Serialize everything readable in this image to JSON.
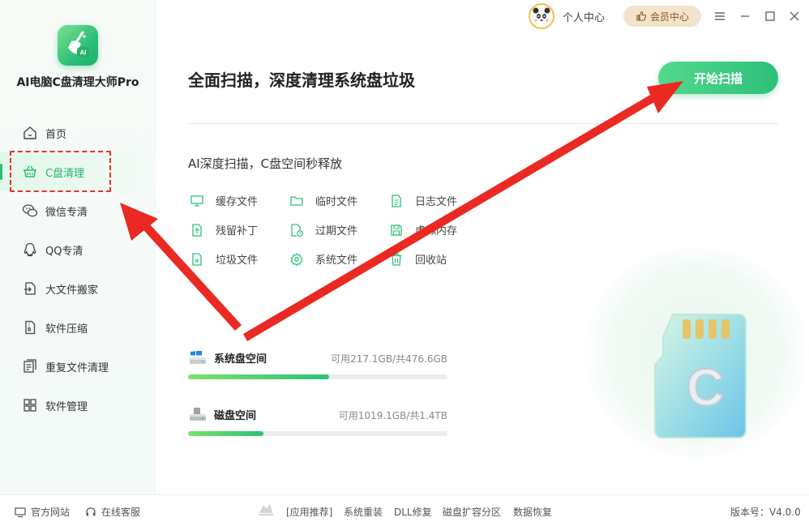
{
  "app": {
    "name": "AI电脑C盘清理大师Pro"
  },
  "topbar": {
    "user_center": "个人中心",
    "vip": "会员中心"
  },
  "sidebar": {
    "items": [
      {
        "label": "首页",
        "icon": "home-icon"
      },
      {
        "label": "C盘清理",
        "icon": "basket-icon",
        "active": true
      },
      {
        "label": "微信专清",
        "icon": "wechat-icon"
      },
      {
        "label": "QQ专清",
        "icon": "qq-icon"
      },
      {
        "label": "大文件搬家",
        "icon": "move-file-icon"
      },
      {
        "label": "软件压缩",
        "icon": "zip-icon"
      },
      {
        "label": "重复文件清理",
        "icon": "duplicate-file-icon"
      },
      {
        "label": "软件管理",
        "icon": "apps-grid-icon"
      }
    ]
  },
  "main": {
    "headline": "全面扫描，深度清理系统盘垃圾",
    "scan_button": "开始扫描",
    "subhead": "AI深度扫描，C盘空间秒释放",
    "features": [
      {
        "label": "缓存文件",
        "icon": "monitor-icon"
      },
      {
        "label": "临时文件",
        "icon": "folder-icon"
      },
      {
        "label": "日志文件",
        "icon": "log-file-icon"
      },
      {
        "label": "残留补丁",
        "icon": "patch-icon"
      },
      {
        "label": "过期文件",
        "icon": "expired-file-icon"
      },
      {
        "label": "虚拟内存",
        "icon": "memory-icon"
      },
      {
        "label": "垃圾文件",
        "icon": "junk-file-icon"
      },
      {
        "label": "系统文件",
        "icon": "gear-icon"
      },
      {
        "label": "回收站",
        "icon": "trash-icon"
      }
    ],
    "disks": [
      {
        "label": "系统盘空间",
        "available": "可用217.1GB/共476.6GB",
        "used_fraction": 0.545
      },
      {
        "label": "磁盘空间",
        "available": "可用1019.1GB/共1.4TB",
        "used_fraction": 0.29
      }
    ],
    "illustration_letter": "C"
  },
  "footer": {
    "official_site": "官方网站",
    "online_service": "在线客服",
    "recommend": "[应用推荐]",
    "links": [
      "系统重装",
      "DLL修复",
      "磁盘扩容分区",
      "数据恢复"
    ],
    "version": "版本号：V4.0.0"
  },
  "colors": {
    "accent": "#2dc07a",
    "highlight_red": "#e8302a",
    "vip_bg": "#f3e3cb"
  }
}
